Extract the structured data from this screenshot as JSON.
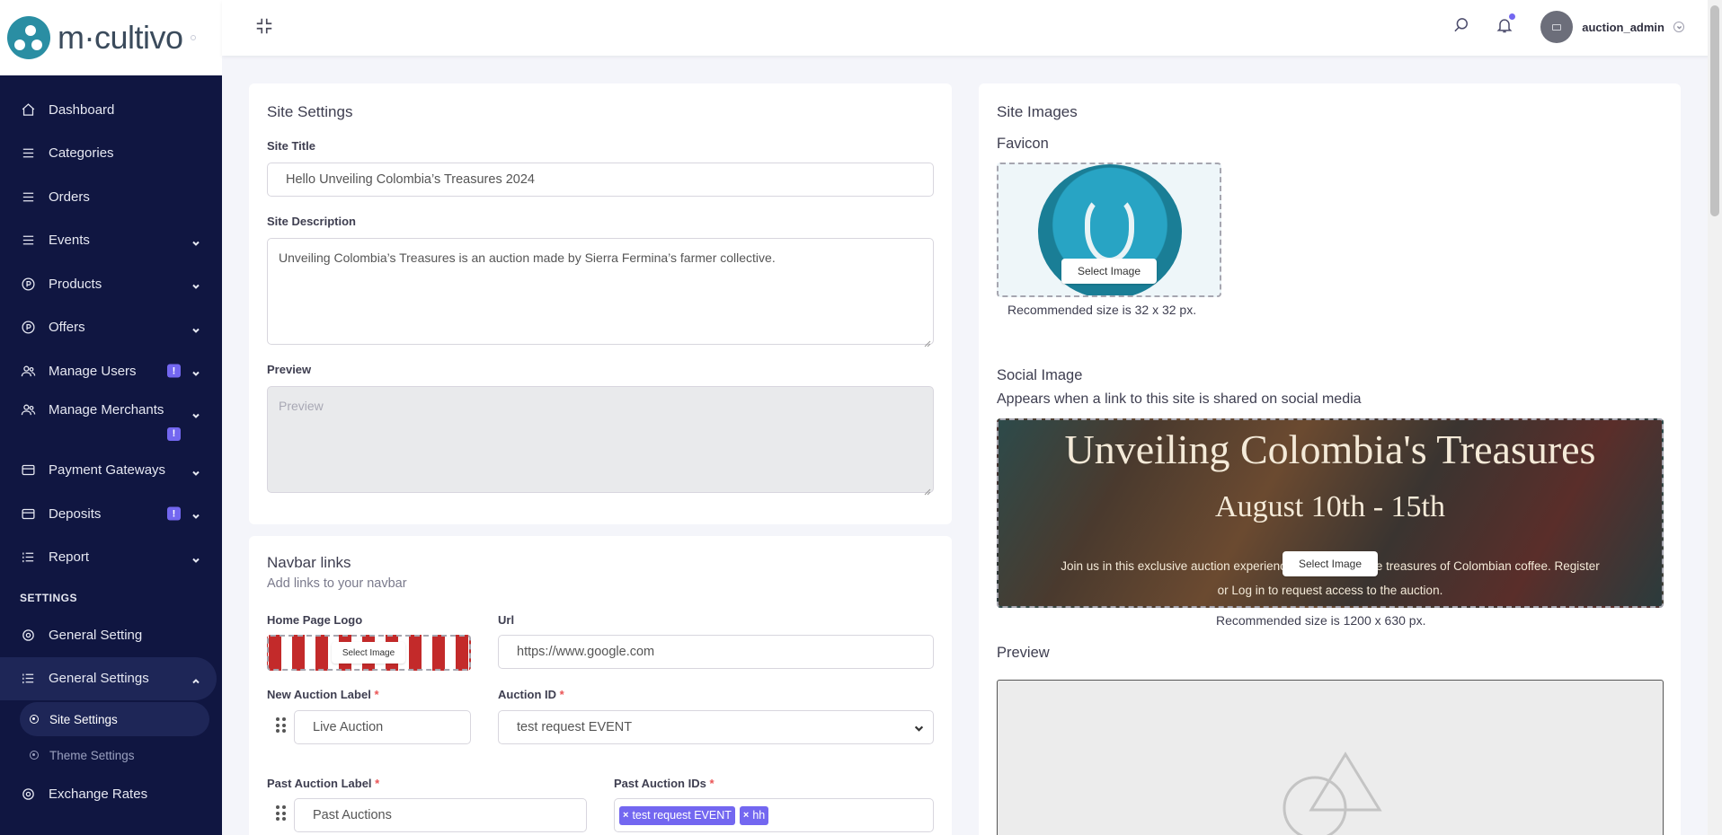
{
  "brand": {
    "name": "m·cultivo"
  },
  "sidebar": {
    "items": [
      {
        "label": "Dashboard",
        "icon": "home-icon"
      },
      {
        "label": "Categories",
        "icon": "list-icon"
      },
      {
        "label": "Orders",
        "icon": "list-icon"
      },
      {
        "label": "Events",
        "icon": "list-icon",
        "expandable": true
      },
      {
        "label": "Products",
        "icon": "p-circle-icon",
        "expandable": true
      },
      {
        "label": "Offers",
        "icon": "p-circle-icon",
        "expandable": true
      },
      {
        "label": "Manage Users",
        "icon": "users-icon",
        "expandable": true,
        "badge": "!"
      },
      {
        "label": "Manage Merchants",
        "icon": "users-icon",
        "expandable": true,
        "badge": "!"
      },
      {
        "label": "Payment Gateways",
        "icon": "card-icon",
        "expandable": true
      },
      {
        "label": "Deposits",
        "icon": "card-icon",
        "expandable": true,
        "badge": "!"
      },
      {
        "label": "Report",
        "icon": "report-icon",
        "expandable": true
      }
    ],
    "settings_heading": "SETTINGS",
    "settings_items": [
      {
        "label": "General Setting",
        "icon": "gear-icon"
      },
      {
        "label": "General Settings",
        "icon": "report-icon",
        "expanded": true
      }
    ],
    "sub_items": [
      {
        "label": "Site Settings",
        "active": true
      },
      {
        "label": "Theme Settings",
        "active": false
      }
    ],
    "bottom_items": [
      {
        "label": "Exchange Rates",
        "icon": "gear-icon"
      }
    ]
  },
  "topbar": {
    "username": "auction_admin"
  },
  "site_settings": {
    "title": "Site Settings",
    "site_title_label": "Site Title",
    "site_title_value": "Hello Unveiling Colombia’s Treasures 2024",
    "site_description_label": "Site Description",
    "site_description_value": "Unveiling Colombia’s Treasures is an auction made by Sierra Fermina’s farmer collective.",
    "preview_label": "Preview",
    "preview_placeholder": "Preview"
  },
  "navbar_links": {
    "title": "Navbar links",
    "subtitle": "Add links to your navbar",
    "home_logo_label": "Home Page Logo",
    "select_image": "Select Image",
    "url_label": "Url",
    "url_value": "https://www.google.com",
    "new_auction_label": "New Auction Label",
    "new_auction_value": "Live Auction",
    "auction_id_label": "Auction ID",
    "auction_id_value": "test request EVENT",
    "past_auction_label": "Past Auction Label",
    "past_auction_value": "Past Auctions",
    "past_auction_ids_label": "Past Auction IDs",
    "past_auction_ids": [
      "test request EVENT",
      "hh"
    ],
    "required_mark": "*"
  },
  "site_images": {
    "title": "Site Images",
    "favicon_label": "Favicon",
    "favicon_select": "Select Image",
    "favicon_note": "Recommended size is 32 x 32 px.",
    "social_label": "Social Image",
    "social_sub": "Appears when a link to this site is shared on social media",
    "social_select": "Select Image",
    "social_note": "Recommended size is 1200 x 630 px.",
    "social_image_title": "Unveiling Colombia's Treasures",
    "social_image_dates": "August 10th - 15th",
    "social_image_line1": "Join us in this exclusive auction experienc",
    "social_image_line1b": "rue treasures of Colombian coffee. Register",
    "social_image_line2": "or Log in to request access to the auction.",
    "preview_label": "Preview"
  },
  "colors": {
    "sidebar_bg": "#101641",
    "accent": "#7367f0",
    "brand_teal": "#2a8ea3"
  }
}
